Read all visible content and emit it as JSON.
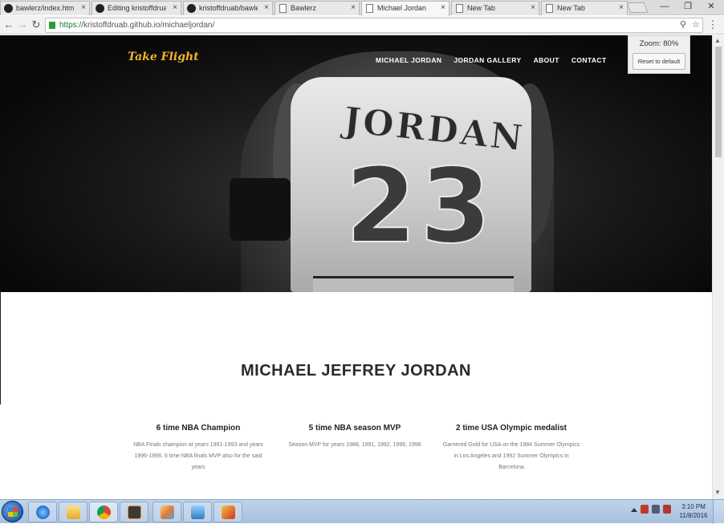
{
  "browser": {
    "tabs": [
      {
        "label": "bawlerz/index.html at",
        "favicon": "github-icon"
      },
      {
        "label": "Editing kristoffdruab",
        "favicon": "github-icon"
      },
      {
        "label": "kristoffdruab/bawlerz",
        "favicon": "github-icon"
      },
      {
        "label": "Bawlerz",
        "favicon": "document-icon"
      },
      {
        "label": "Michael Jordan",
        "favicon": "document-icon",
        "active": true
      },
      {
        "label": "New Tab",
        "favicon": "document-icon"
      },
      {
        "label": "New Tab",
        "favicon": "document-icon"
      }
    ],
    "url": {
      "scheme": "https://",
      "host": "kristoffdruab.github.io",
      "path": "/michaeljordan/"
    },
    "close_glyph": "×",
    "back_glyph": "←",
    "forward_glyph": "→",
    "reload_glyph": "↻",
    "zoom_icon_glyph": "⚲",
    "star_glyph": "☆",
    "menu_glyph": "⋮"
  },
  "zoom_popup": {
    "text": "Zoom: 80%",
    "reset_label": "Reset to default"
  },
  "site": {
    "brand": "Take Flight",
    "nav": [
      "MICHAEL JORDAN",
      "JORDAN GALLERY",
      "ABOUT",
      "CONTACT"
    ],
    "jersey_name": "JORDAN",
    "jersey_number": "23",
    "title": "MICHAEL JEFFREY JORDAN",
    "features": [
      {
        "heading": "6 time NBA Champion",
        "text": "NBA Finals champion at years 1991-1993 and years 1996-1998. 6 time NBA finals MVP also for the said years"
      },
      {
        "heading": "5 time NBA season MVP",
        "text": "Season MVP for years 1988, 1991, 1992, 1996, 1998"
      },
      {
        "heading": "2 time USA Olympic medalist",
        "text": "Garnered Gold for USA on the 1984 Summer Olympics in Los Angeles and 1992 Summer Olympics in Barcelona"
      }
    ]
  },
  "taskbar": {
    "time": "3:10 PM",
    "date": "11/8/2016",
    "apps": [
      "internet-explorer-icon",
      "file-explorer-icon",
      "chrome-icon",
      "sublime-icon",
      "paint-icon",
      "photos-icon",
      "media-icon"
    ]
  },
  "colors": {
    "brand_yellow": "#f0b429",
    "hero_dark": "#111111",
    "url_green": "#1b7a2b",
    "taskbar_blue": "#a7c0de"
  }
}
